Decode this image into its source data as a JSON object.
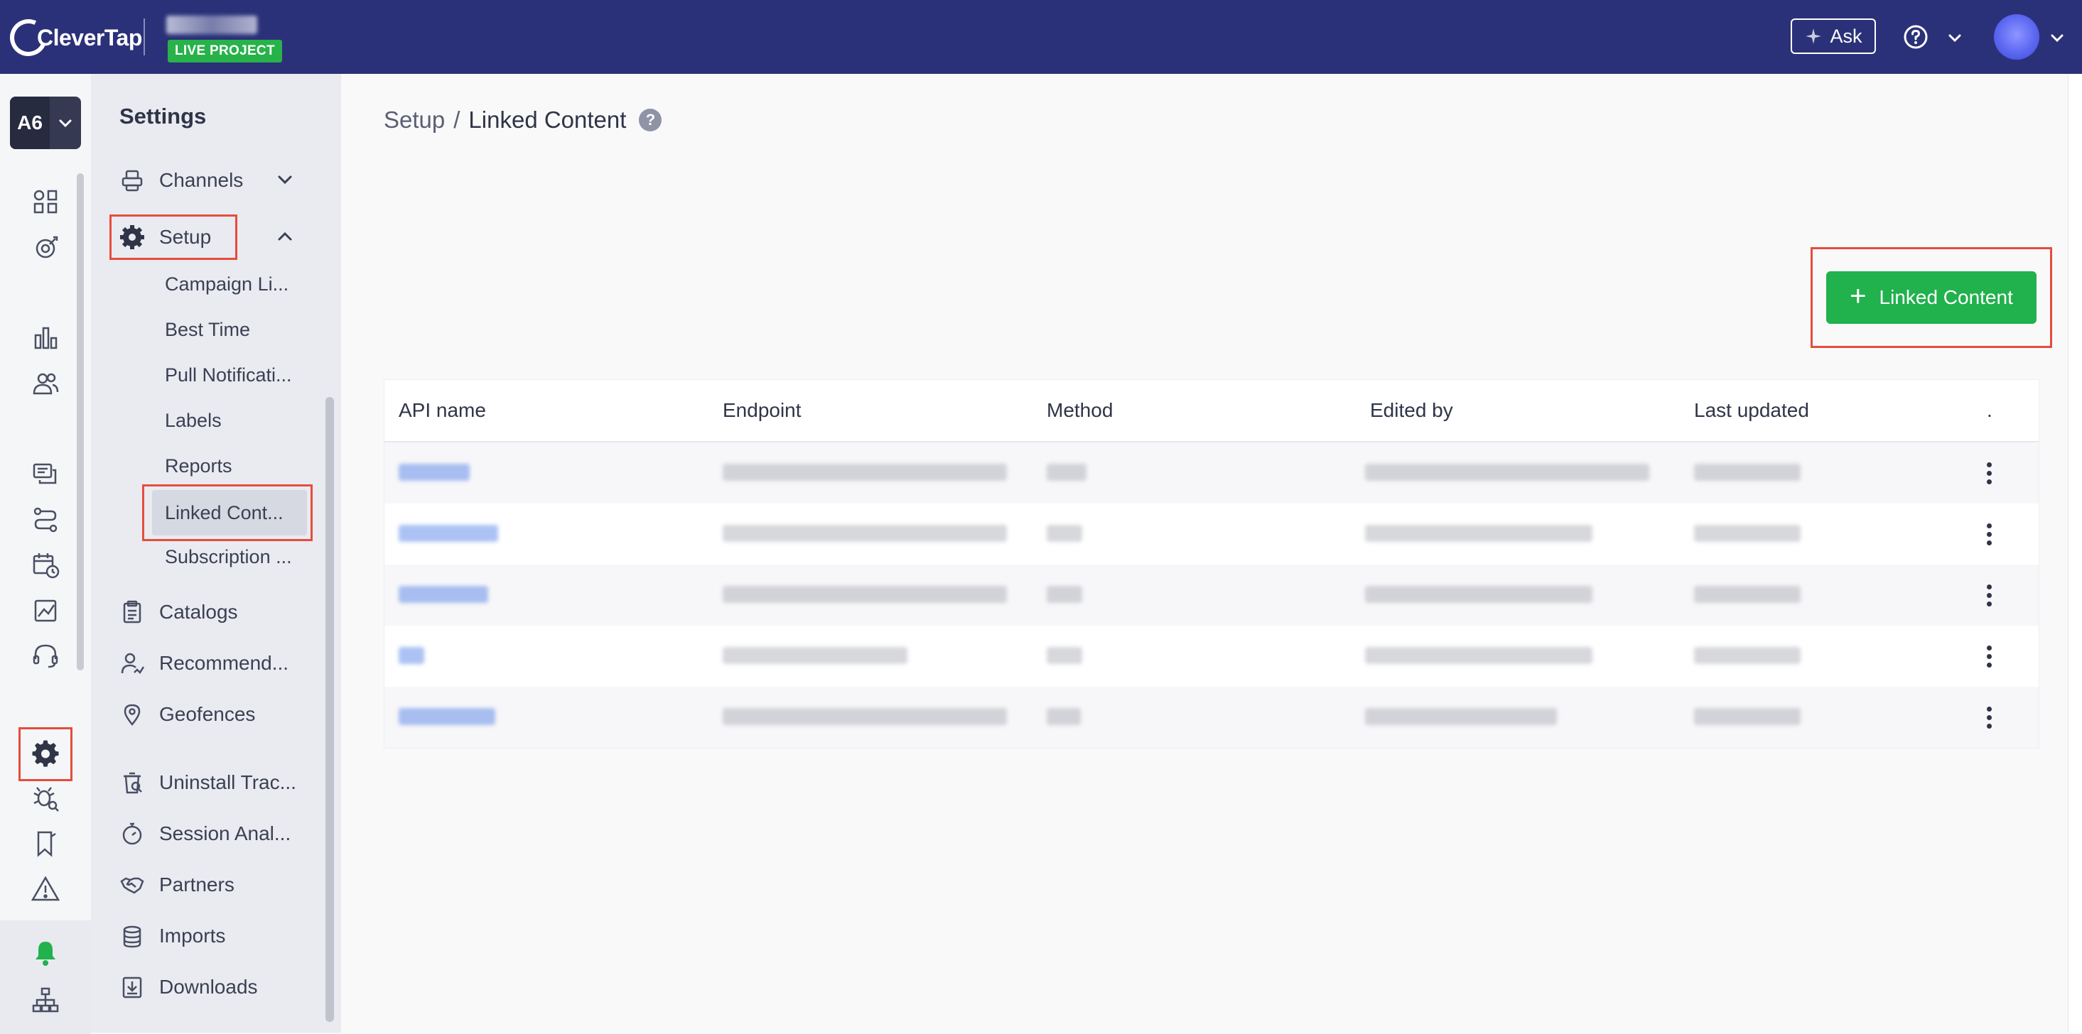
{
  "topbar": {
    "brand": "CleverTap",
    "project_badge": "LIVE PROJECT",
    "ask_label": "Ask",
    "help_icon": "question-circle-icon",
    "avatar_color": "#5c67f2",
    "background": "#2b3178"
  },
  "rail": {
    "account_label": "A6",
    "icons": [
      "boards-icon",
      "journeys-icon",
      "analytics-icon",
      "segments-icon",
      "messages-icon",
      "flows-icon",
      "campaign-calendar-icon",
      "reports-icon",
      "support-icon",
      "settings-icon",
      "debug-icon",
      "bookmark-icon",
      "alert-icon",
      "bell-icon",
      "sitemap-icon"
    ]
  },
  "settings": {
    "title": "Settings",
    "channels": "Channels",
    "setup": "Setup",
    "sub_items": [
      "Campaign Li...",
      "Best Time",
      "Pull Notificati...",
      "Labels",
      "Reports",
      "Linked Cont...",
      "Subscription ..."
    ],
    "items": [
      "Catalogs",
      "Recommend...",
      "Geofences",
      "Uninstall Trac...",
      "Session Anal...",
      "Partners",
      "Imports",
      "Downloads"
    ]
  },
  "main": {
    "breadcrumb_parent": "Setup",
    "breadcrumb_sep": "/",
    "breadcrumb_current": "Linked Content",
    "help_glyph": "?",
    "add_button_label": "Linked Content",
    "accent_color": "#21b14d",
    "table": {
      "columns": [
        "API name",
        "Endpoint",
        "Method",
        "Edited by",
        "Last updated",
        "."
      ],
      "row_count_visible": 5
    }
  }
}
